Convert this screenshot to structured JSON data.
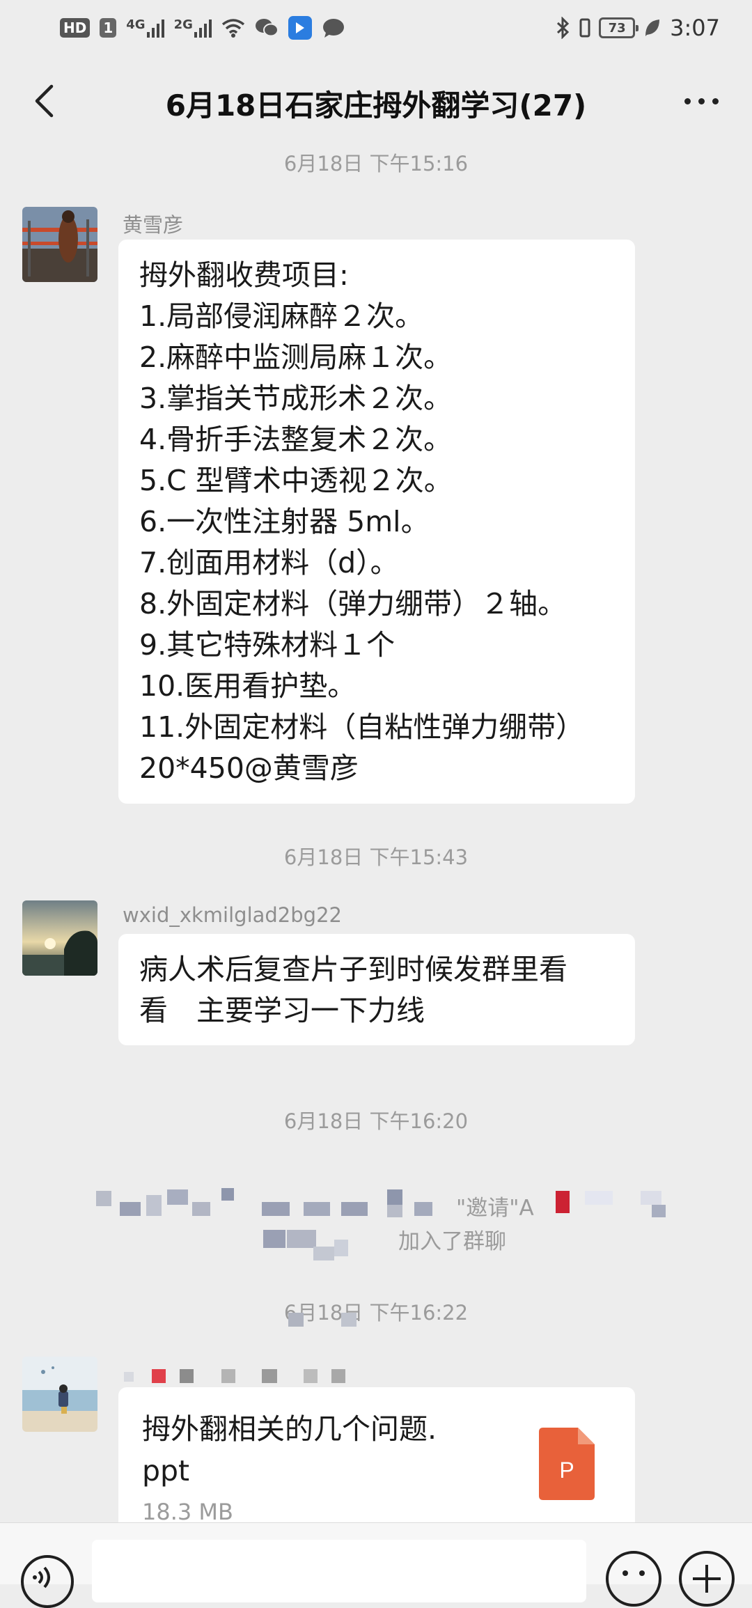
{
  "status_bar": {
    "hd_badge": "HD",
    "sim_badge": "1",
    "net1": "4G",
    "net2": "2G",
    "battery": "73",
    "time": "3:07"
  },
  "header": {
    "title": "6月18日石家庄拇外翻学习(27)"
  },
  "messages": [
    {
      "timestamp": "6月18日 下午15:16",
      "sender": "黄雪彦",
      "lines": [
        "拇外翻收费项目:",
        "1.局部侵润麻醉２次。",
        "2.麻醉中监测局麻１次。",
        "3.掌指关节成形术２次。",
        "4.骨折手法整复术２次。",
        "5.C 型臂术中透视２次。",
        "6.一次性注射器 5ml。",
        "7.创面用材料（d）。",
        "8.外固定材料（弹力绷带）２轴。",
        "9.其它特殊材料１个",
        "10.医用看护垫。",
        "11.外固定材料（自粘性弹力绷带）",
        "20*450@黄雪彦"
      ]
    },
    {
      "timestamp": "6月18日 下午15:43",
      "sender": "wxid_xkmilglad2bg22",
      "lines": [
        "病人术后复查片子到时候发群里看",
        "看　主要学习一下力线"
      ]
    }
  ],
  "system_notice": {
    "timestamp": "6月18日 下午16:20",
    "invite_text": "\"邀请\"A",
    "joined_text": "加入了群聊"
  },
  "file_message": {
    "timestamp": "6月18日 下午16:22",
    "file_name_line1": "拇外翻相关的几个问题.",
    "file_name_line2": "ppt",
    "file_size": "18.3 MB",
    "file_type_letter": "P"
  },
  "colors": {
    "background": "#ededed",
    "bubble": "#ffffff",
    "timestamp": "#9b9b9b",
    "ppt_icon": "#e8613a"
  }
}
